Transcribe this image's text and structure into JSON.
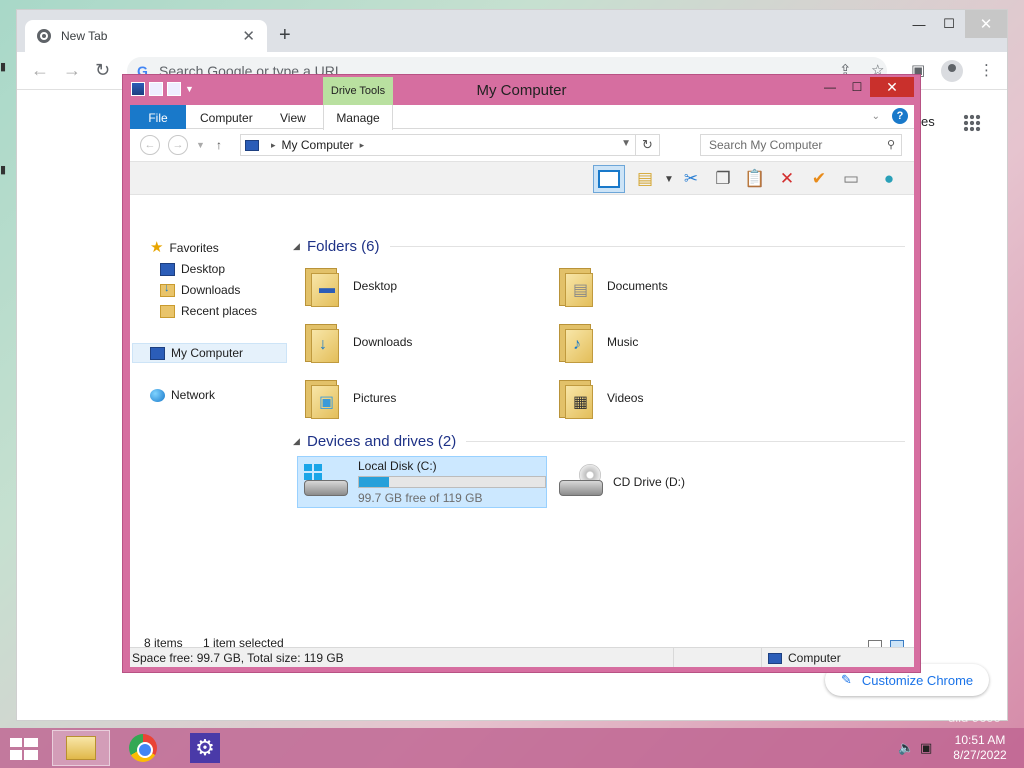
{
  "chrome": {
    "tab_title": "New Tab",
    "tab_close": "✕",
    "new_tab": "+",
    "omnibox_placeholder": "Search Google or type a URL",
    "google_shortcut_text": "es",
    "customize_button": "Customize Chrome",
    "window_min": "—",
    "window_max": "☐",
    "window_close": "✕"
  },
  "explorer": {
    "title": "My Computer",
    "contextual_tab": "Drive Tools",
    "window_min": "—",
    "window_max": "☐",
    "window_close": "✕",
    "ribbon_tabs": [
      "File",
      "Computer",
      "View",
      "Manage"
    ],
    "address": {
      "location": "My Computer"
    },
    "search_placeholder": "Search My Computer",
    "nav_pane": {
      "favorites": "Favorites",
      "favorite_items": [
        "Desktop",
        "Downloads",
        "Recent places"
      ],
      "my_computer": "My Computer",
      "network": "Network"
    },
    "folders_group": "Folders (6)",
    "folders": [
      {
        "name": "Desktop",
        "icon": "desktop-folder-icon"
      },
      {
        "name": "Documents",
        "icon": "documents-folder-icon"
      },
      {
        "name": "Downloads",
        "icon": "downloads-folder-icon"
      },
      {
        "name": "Music",
        "icon": "music-folder-icon"
      },
      {
        "name": "Pictures",
        "icon": "pictures-folder-icon"
      },
      {
        "name": "Videos",
        "icon": "videos-folder-icon"
      }
    ],
    "drives_group": "Devices and drives (2)",
    "drives": [
      {
        "name": "Local Disk (C:)",
        "free_text": "99.7 GB free of 119 GB",
        "used_fraction": 0.16,
        "selected": true
      },
      {
        "name": "CD Drive (D:)"
      }
    ],
    "status": {
      "items": "8 items",
      "selected": "1 item selected"
    },
    "details": {
      "space": "Space free: 99.7 GB, Total size: 119 GB",
      "location": "Computer"
    }
  },
  "taskbar": {
    "time": "10:51 AM",
    "date": "8/27/2022"
  },
  "desktop": {
    "watermark": "uild 9600"
  },
  "colors": {
    "window_frame": "#d66ea0",
    "accent_blue": "#1979ca",
    "contextual_tab": "#b9e0a0",
    "close_red": "#c9302c",
    "disk_bar": "#26a0da"
  }
}
